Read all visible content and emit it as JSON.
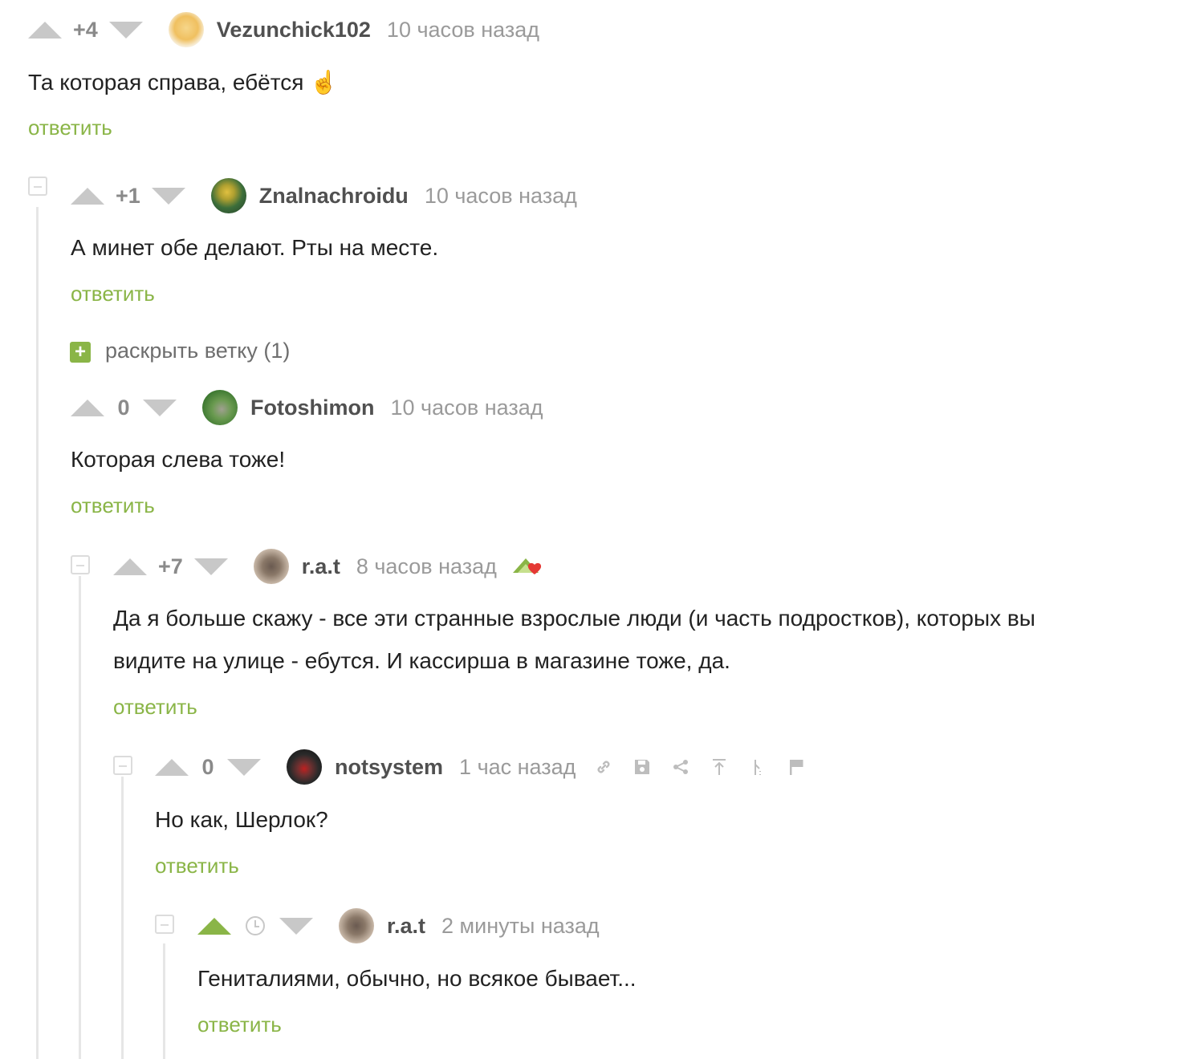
{
  "comments": [
    {
      "rating": "+4",
      "author": "Vezunchick102",
      "time": "10 часов назад",
      "text": "Та которая справа, ебётся ☝️",
      "reply": "ответить"
    },
    {
      "rating": "+1",
      "author": "Znalnachroidu",
      "time": "10 часов назад",
      "text": "А минет обе делают. Рты на месте.",
      "reply": "ответить"
    },
    {
      "rating": "0",
      "author": "Fotoshimon",
      "time": "10 часов назад",
      "text": "Которая слева тоже!",
      "reply": "ответить"
    },
    {
      "rating": "+7",
      "author": "r.a.t",
      "time": "8 часов назад",
      "text_line1": "Да я больше скажу - все эти странные взрослые люди (и часть подростков), которых вы",
      "text_line2": "видите на улице - ебутся. И кассирша в магазине тоже, да.",
      "reply": "ответить"
    },
    {
      "rating": "0",
      "author": "notsystem",
      "time": "1 час назад",
      "text": "Но как, Шерлок?",
      "reply": "ответить"
    },
    {
      "author": "r.a.t",
      "time": "2 минуты назад",
      "text": "Гениталиями, обычно, но всякое бывает...",
      "reply": "ответить"
    }
  ],
  "expand_thread": {
    "icon": "+",
    "label": "раскрыть ветку (1)"
  },
  "icons": [
    "arrow-up-icon",
    "arrow-down-icon",
    "link-icon",
    "save-icon",
    "share-icon",
    "scroll-to-top-icon",
    "hide-icon",
    "report-flag-icon",
    "clock-icon",
    "heart-badge-icon"
  ],
  "colors": {
    "accent": "#8ab547",
    "muted": "#9a9a9a",
    "vote": "#c8c8c8"
  }
}
